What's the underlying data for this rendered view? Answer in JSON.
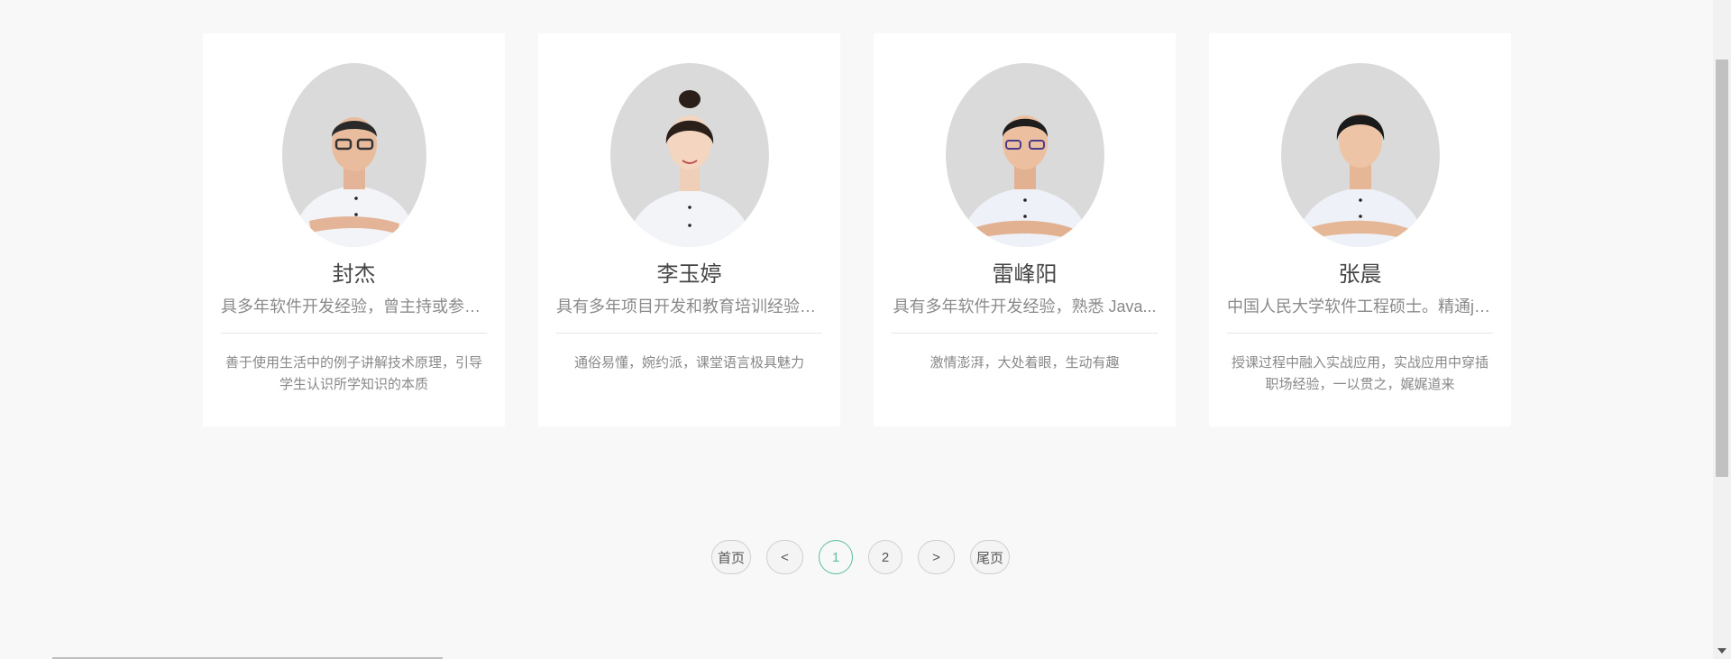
{
  "teachers": [
    {
      "name": "封杰",
      "title": "具多年软件开发经验，曾主持或参与...",
      "description": "善于使用生活中的例子讲解技术原理，引导学生认识所学知识的本质",
      "avatar_icon": "teacher-photo-male-glasses"
    },
    {
      "name": "李玉婷",
      "title": "具有多年项目开发和教育培训经验，...",
      "description": "通俗易懂，婉约派，课堂语言极具魅力",
      "avatar_icon": "teacher-photo-female"
    },
    {
      "name": "雷峰阳",
      "title": "具有多年软件开发经验，熟悉 Java...",
      "description": "激情澎湃，大处着眼，生动有趣",
      "avatar_icon": "teacher-photo-male-glasses"
    },
    {
      "name": "张晨",
      "title": "中国人民大学软件工程硕士。精通ja...",
      "description": "授课过程中融入实战应用，实战应用中穿插职场经验，一以贯之，娓娓道来",
      "avatar_icon": "teacher-photo-male"
    }
  ],
  "pagination": {
    "first": "首页",
    "prev": "<",
    "pages": [
      "1",
      "2"
    ],
    "current": "1",
    "next": ">",
    "last": "尾页"
  },
  "colors": {
    "accent": "#5cbfa3",
    "card_bg": "#ffffff",
    "page_bg": "#f8f8f8"
  }
}
